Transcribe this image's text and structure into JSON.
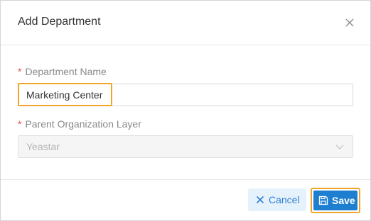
{
  "dialog": {
    "title": "Add Department",
    "close_icon": "close-icon"
  },
  "form": {
    "department_name": {
      "required_marker": "*",
      "label": "Department Name",
      "value": "Marketing Center"
    },
    "parent_layer": {
      "required_marker": "*",
      "label": "Parent Organization Layer",
      "value": "Yeastar",
      "disabled": true,
      "icon": "chevron-down-icon"
    }
  },
  "footer": {
    "cancel_label": "Cancel",
    "cancel_icon": "close-icon",
    "save_label": "Save",
    "save_icon": "save-icon"
  },
  "colors": {
    "primary": "#1e7fd1",
    "highlight": "#f0a42a",
    "required": "#e5484d",
    "cancel_bg": "#e6f2fb"
  }
}
